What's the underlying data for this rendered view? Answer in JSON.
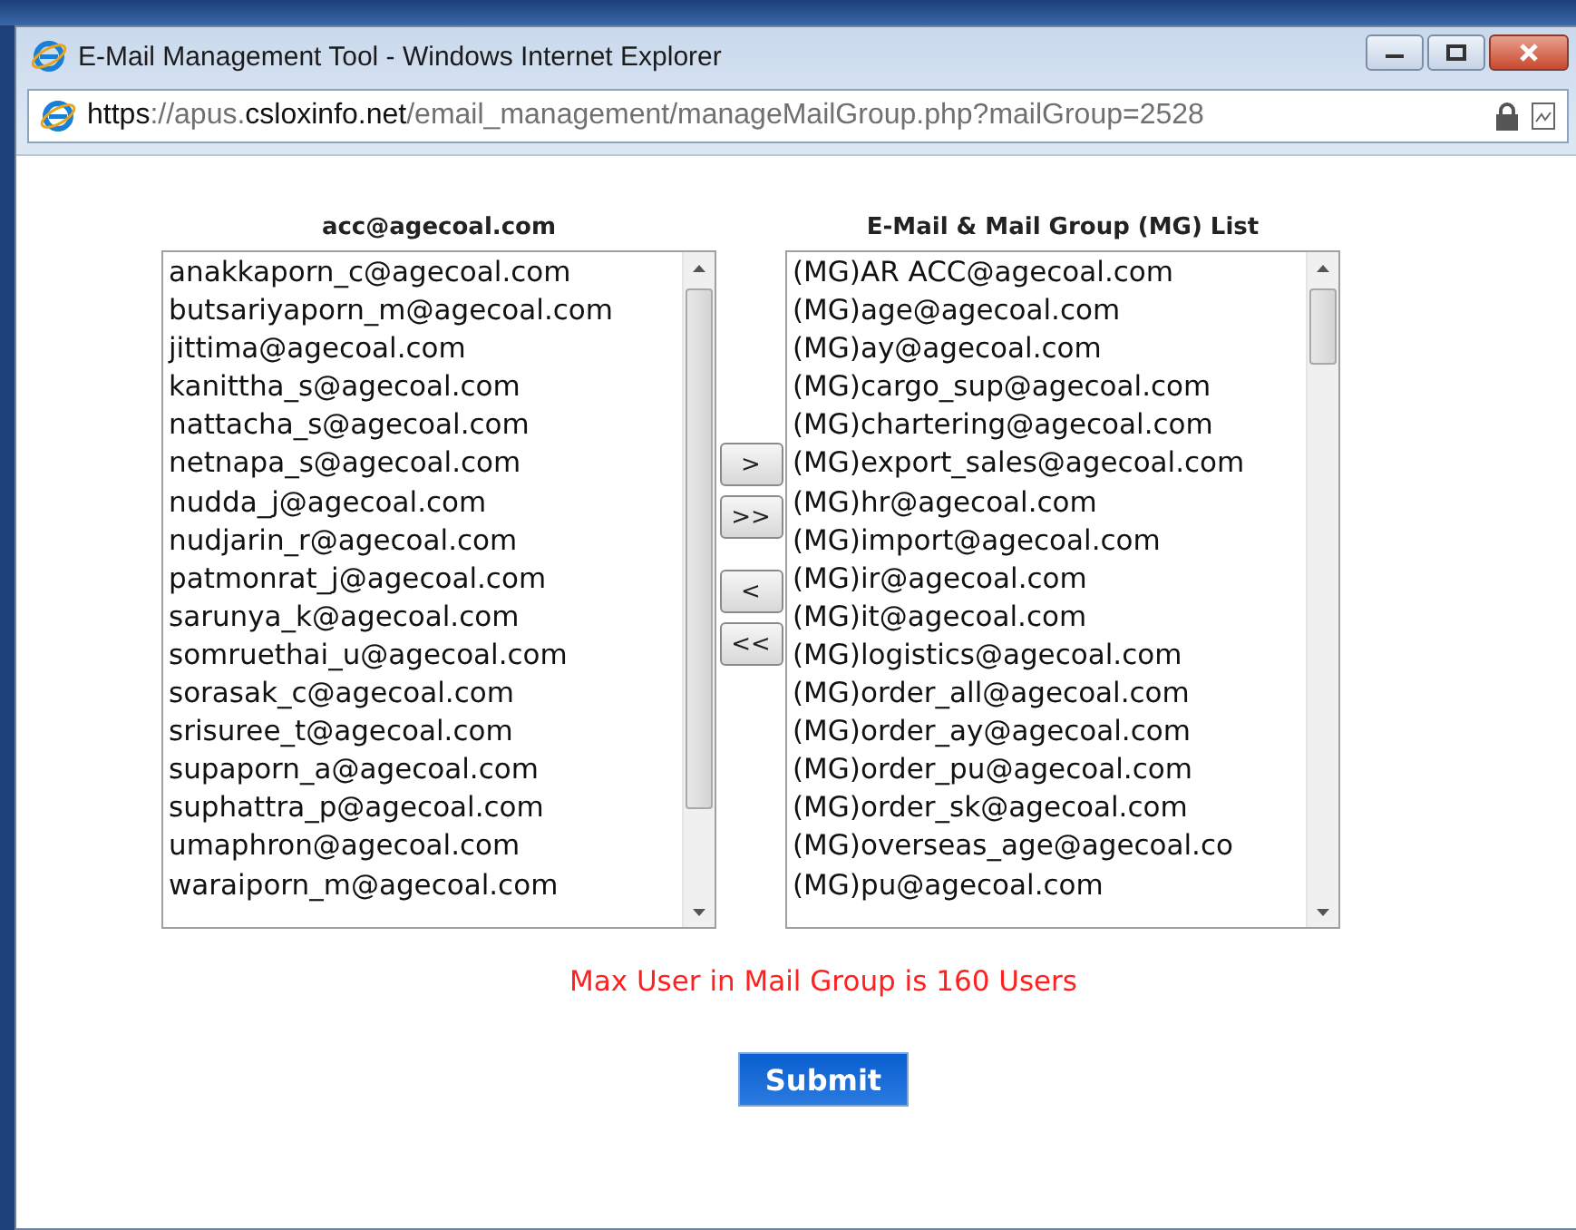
{
  "window": {
    "title": "E-Mail Management Tool - Windows Internet Explorer"
  },
  "address_bar": {
    "scheme": "https",
    "host": "://apus.",
    "domain": "csloxinfo.net",
    "path": "/email_management/manageMailGroup.php?mailGroup=2528"
  },
  "members": {
    "title": "acc@agecoal.com",
    "items": [
      {
        "label": "anakkaporn_c@agecoal.com",
        "selected": false
      },
      {
        "label": "butsariyaporn_m@agecoal.com",
        "selected": false
      },
      {
        "label": "jittima@agecoal.com",
        "selected": false
      },
      {
        "label": "kanittha_s@agecoal.com",
        "selected": false
      },
      {
        "label": "nattacha_s@agecoal.com",
        "selected": false
      },
      {
        "label": "netnapa_s@agecoal.com",
        "selected": false
      },
      {
        "label": "nudda_j@agecoal.com",
        "selected": false
      },
      {
        "label": "nudjarin_r@agecoal.com",
        "selected": false
      },
      {
        "label": "patmonrat_j@agecoal.com",
        "selected": false
      },
      {
        "label": "sarunya_k@agecoal.com",
        "selected": false
      },
      {
        "label": "somruethai_u@agecoal.com",
        "selected": false
      },
      {
        "label": "sorasak_c@agecoal.com",
        "selected": false
      },
      {
        "label": "srisuree_t@agecoal.com",
        "selected": false
      },
      {
        "label": "supaporn_a@agecoal.com",
        "selected": false
      },
      {
        "label": "suphattra_p@agecoal.com",
        "selected": false
      },
      {
        "label": "umaphron@agecoal.com",
        "selected": false
      },
      {
        "label": "waraiporn_m@agecoal.com",
        "selected": false
      }
    ]
  },
  "move_buttons": [
    ">",
    ">>",
    "<",
    "<<"
  ],
  "available": {
    "title": "E-Mail & Mail Group (MG) List",
    "items": [
      {
        "label": "(MG)AR ACC@agecoal.com",
        "selected": false
      },
      {
        "label": "(MG)age@agecoal.com",
        "selected": false
      },
      {
        "label": "(MG)ay@agecoal.com",
        "selected": false
      },
      {
        "label": "(MG)cargo_sup@agecoal.com",
        "selected": false
      },
      {
        "label": "(MG)chartering@agecoal.com",
        "selected": false
      },
      {
        "label": "(MG)export_sales@agecoal.com",
        "selected": false
      },
      {
        "label": "(MG)hr@agecoal.com",
        "selected": false
      },
      {
        "label": "(MG)import@agecoal.com",
        "selected": false
      },
      {
        "label": "(MG)ir@agecoal.com",
        "selected": false
      },
      {
        "label": "(MG)it@agecoal.com",
        "selected": false
      },
      {
        "label": "(MG)logistics@agecoal.com",
        "selected": false
      },
      {
        "label": "(MG)order_all@agecoal.com",
        "selected": false
      },
      {
        "label": "(MG)order_ay@agecoal.com",
        "selected": false
      },
      {
        "label": "(MG)order_pu@agecoal.com",
        "selected": false
      },
      {
        "label": "(MG)order_sk@agecoal.com",
        "selected": false
      },
      {
        "label": "(MG)overseas_age@agecoal.co",
        "selected": false
      },
      {
        "label": "(MG)pu@agecoal.com",
        "selected": false
      }
    ]
  },
  "notice": "Max User in Mail Group is 160 Users",
  "submit": "Submit"
}
